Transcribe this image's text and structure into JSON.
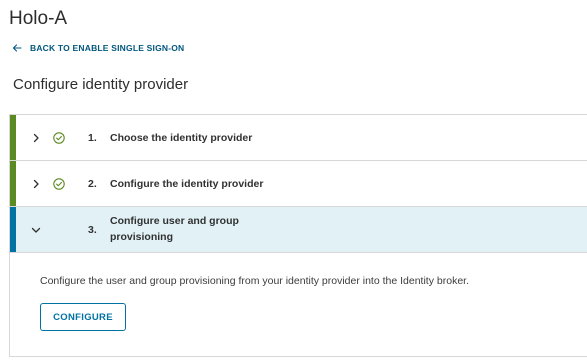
{
  "header": {
    "app_title": "Holo-A",
    "back_link": "BACK TO ENABLE SINGLE SIGN-ON",
    "page_title": "Configure identity provider"
  },
  "colors": {
    "complete_bar": "#5b8a22",
    "active_bar": "#0072a3",
    "active_row_bg": "#e1f1f6",
    "link": "#00567f"
  },
  "steps": [
    {
      "number": "1.",
      "label": "Choose the identity provider",
      "status": "complete",
      "icon": "check-circle-icon",
      "expanded": false
    },
    {
      "number": "2.",
      "label": "Configure the identity provider",
      "status": "complete",
      "icon": "check-circle-icon",
      "expanded": false
    },
    {
      "number": "3.",
      "label": "Configure user and group provisioning",
      "status": "active",
      "expanded": true,
      "description": "Configure the user and group provisioning from your identity provider into the Identity broker.",
      "button_label": "CONFIGURE"
    }
  ]
}
